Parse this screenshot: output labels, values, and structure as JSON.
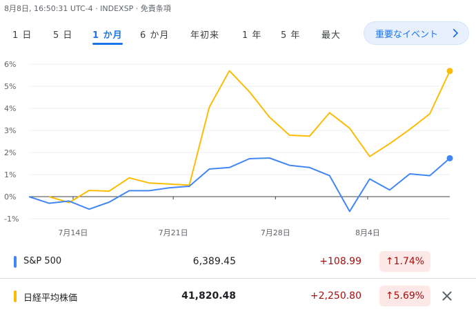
{
  "header": {
    "meta": "8月8日, 16:50:31 UTC-4 · INDEXSP · 免責条項"
  },
  "tabs": [
    {
      "label": "1 日",
      "active": false
    },
    {
      "label": "5 日",
      "active": false
    },
    {
      "label": "1 か月",
      "active": true
    },
    {
      "label": "6 か月",
      "active": false
    },
    {
      "label": "年初来",
      "active": false
    },
    {
      "label": "1 年",
      "active": false
    },
    {
      "label": "5 年",
      "active": false
    },
    {
      "label": "最大",
      "active": false
    }
  ],
  "events_button": {
    "label": "重要なイベント",
    "icon": "chevron-right-icon"
  },
  "chart_data": {
    "type": "line",
    "y_ticks": [
      "6%",
      "5%",
      "4%",
      "3%",
      "2%",
      "1%",
      "0%",
      "-1%"
    ],
    "x_ticks": [
      "7月14日",
      "7月21日",
      "7月28日",
      "8月4日"
    ],
    "ylim": [
      -1,
      6
    ],
    "grid": true,
    "series": [
      {
        "name": "S&P 500",
        "color": "#4285f4",
        "points": [
          [
            0,
            0
          ],
          [
            1,
            -0.3
          ],
          [
            2,
            -0.2
          ],
          [
            3,
            -0.57
          ],
          [
            4,
            -0.25
          ],
          [
            5,
            0.27
          ],
          [
            6,
            0.27
          ],
          [
            7,
            0.4
          ],
          [
            8,
            0.47
          ],
          [
            9,
            1.25
          ],
          [
            10,
            1.32
          ],
          [
            11,
            1.72
          ],
          [
            12,
            1.75
          ],
          [
            13,
            1.42
          ],
          [
            14,
            1.32
          ],
          [
            15,
            0.95
          ],
          [
            16,
            -0.67
          ],
          [
            17,
            0.8
          ],
          [
            18,
            0.3
          ],
          [
            19,
            1.03
          ],
          [
            20,
            0.95
          ],
          [
            21,
            1.74
          ]
        ]
      },
      {
        "name": "日経平均株価",
        "color": "#fbbc04",
        "points": [
          [
            1,
            0
          ],
          [
            2,
            -0.27
          ],
          [
            3,
            0.28
          ],
          [
            4,
            0.25
          ],
          [
            5,
            0.85
          ],
          [
            6,
            0.62
          ],
          [
            7,
            0.57
          ],
          [
            8,
            0.52
          ],
          [
            9,
            4.05
          ],
          [
            10,
            5.7
          ],
          [
            11,
            4.75
          ],
          [
            12,
            3.6
          ],
          [
            13,
            2.78
          ],
          [
            14,
            2.74
          ],
          [
            15,
            3.8
          ],
          [
            16,
            3.1
          ],
          [
            17,
            1.82
          ],
          [
            18,
            2.4
          ],
          [
            19,
            3.05
          ],
          [
            20,
            3.75
          ],
          [
            21,
            5.69
          ]
        ]
      }
    ]
  },
  "legend": [
    {
      "name": "S&P 500",
      "price": "6,389.45",
      "change": "+108.99",
      "percent": "1.74%",
      "color": "#4285f4"
    },
    {
      "name": "日経平均株価",
      "price": "41,820.48",
      "change": "+2,250.80",
      "percent": "5.69%",
      "color": "#fbbc04"
    }
  ]
}
